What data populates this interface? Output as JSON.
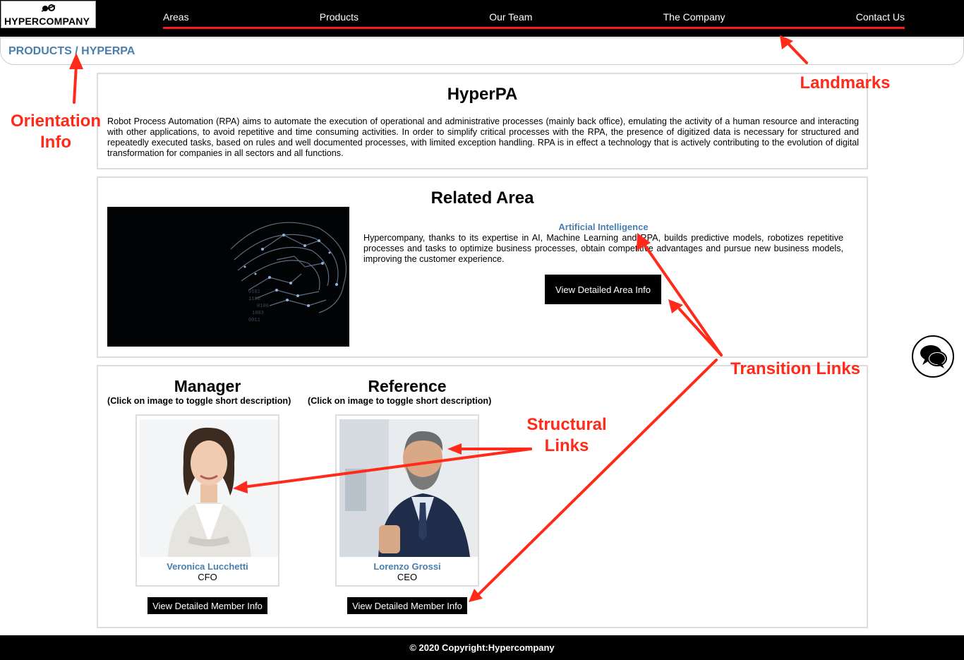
{
  "header": {
    "logo_text": "HYPERCOMPANY",
    "nav": [
      "Areas",
      "Products",
      "Our Team",
      "The Company",
      "Contact Us"
    ]
  },
  "breadcrumb": {
    "parent": "PRODUCTS",
    "separator": "/",
    "current": "HYPERPA"
  },
  "product": {
    "title": "HyperPA",
    "description": "Robot Process Automation (RPA) aims to automate the execution of operational and administrative processes (mainly back office), emulating the activity of a human resource and interacting with other applications, to avoid repetitive and time consuming activities. In order to simplify critical processes with the RPA, the presence of digitized data is necessary for structured and repeatedly executed tasks, based on rules and well documented processes, with limited exception handling. RPA is in effect a technology that is actively contributing to the evolution of digital transformation for companies in all sectors and all functions."
  },
  "related_area": {
    "heading": "Related Area",
    "name": "Artificial Intelligence",
    "description": "Hypercompany, thanks to its expertise in AI, Machine Learning and RPA, builds predictive models, robotizes repetitive processes and tasks to optimize business processes, obtain competitive advantages and pursue new business models, improving the customer experience.",
    "button": "View Detailed Area Info"
  },
  "team": {
    "manager": {
      "heading": "Manager",
      "hint": "(Click on image to toggle short description)",
      "name": "Veronica Lucchetti",
      "role": "CFO",
      "button": "View Detailed Member Info"
    },
    "reference": {
      "heading": "Reference",
      "hint": "(Click on image to toggle short description)",
      "name": "Lorenzo Grossi",
      "role": "CEO",
      "button": "View Detailed Member Info"
    }
  },
  "footer": {
    "text": "© 2020  Copyright:Hypercompany"
  },
  "annotations": {
    "orientation": [
      "Orientation",
      "Info"
    ],
    "landmarks": "Landmarks",
    "transition": "Transition Links",
    "structural": [
      "Structural",
      "Links"
    ],
    "color": "#ff2a1a"
  },
  "icons": [
    "logo-mark-icon",
    "chat-bubbles-icon"
  ]
}
